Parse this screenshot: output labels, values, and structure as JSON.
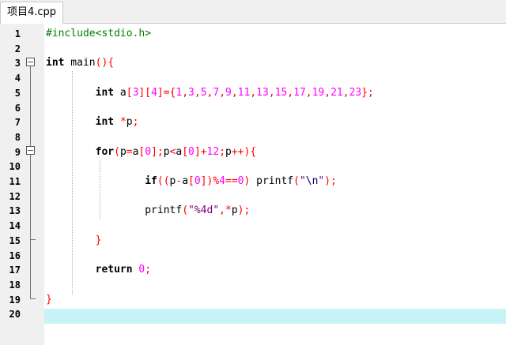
{
  "tab": {
    "label": "项目4.cpp"
  },
  "lines": [
    {
      "num": "1",
      "tokens": [
        {
          "t": "#include<stdio.h>",
          "c": "pp"
        }
      ]
    },
    {
      "num": "2",
      "tokens": []
    },
    {
      "num": "3",
      "tokens": [
        {
          "t": "int",
          "c": "kw"
        },
        {
          "t": " main",
          "c": ""
        },
        {
          "t": "(){",
          "c": "op"
        }
      ]
    },
    {
      "num": "4",
      "tokens": []
    },
    {
      "num": "5",
      "tokens": [
        {
          "t": "        ",
          "c": ""
        },
        {
          "t": "int",
          "c": "kw"
        },
        {
          "t": " a",
          "c": ""
        },
        {
          "t": "[",
          "c": "op"
        },
        {
          "t": "3",
          "c": "num"
        },
        {
          "t": "][",
          "c": "op"
        },
        {
          "t": "4",
          "c": "num"
        },
        {
          "t": "]={",
          "c": "op"
        },
        {
          "t": "1",
          "c": "num"
        },
        {
          "t": ",",
          "c": "op"
        },
        {
          "t": "3",
          "c": "num"
        },
        {
          "t": ",",
          "c": "op"
        },
        {
          "t": "5",
          "c": "num"
        },
        {
          "t": ",",
          "c": "op"
        },
        {
          "t": "7",
          "c": "num"
        },
        {
          "t": ",",
          "c": "op"
        },
        {
          "t": "9",
          "c": "num"
        },
        {
          "t": ",",
          "c": "op"
        },
        {
          "t": "11",
          "c": "num"
        },
        {
          "t": ",",
          "c": "op"
        },
        {
          "t": "13",
          "c": "num"
        },
        {
          "t": ",",
          "c": "op"
        },
        {
          "t": "15",
          "c": "num"
        },
        {
          "t": ",",
          "c": "op"
        },
        {
          "t": "17",
          "c": "num"
        },
        {
          "t": ",",
          "c": "op"
        },
        {
          "t": "19",
          "c": "num"
        },
        {
          "t": ",",
          "c": "op"
        },
        {
          "t": "21",
          "c": "num"
        },
        {
          "t": ",",
          "c": "op"
        },
        {
          "t": "23",
          "c": "num"
        },
        {
          "t": "};",
          "c": "op"
        }
      ]
    },
    {
      "num": "6",
      "tokens": []
    },
    {
      "num": "7",
      "tokens": [
        {
          "t": "        ",
          "c": ""
        },
        {
          "t": "int",
          "c": "kw"
        },
        {
          "t": " ",
          "c": ""
        },
        {
          "t": "*",
          "c": "op"
        },
        {
          "t": "p",
          "c": ""
        },
        {
          "t": ";",
          "c": "op"
        }
      ]
    },
    {
      "num": "8",
      "tokens": []
    },
    {
      "num": "9",
      "tokens": [
        {
          "t": "        ",
          "c": ""
        },
        {
          "t": "for",
          "c": "kw"
        },
        {
          "t": "(",
          "c": "op"
        },
        {
          "t": "p",
          "c": ""
        },
        {
          "t": "=",
          "c": "op"
        },
        {
          "t": "a",
          "c": ""
        },
        {
          "t": "[",
          "c": "op"
        },
        {
          "t": "0",
          "c": "num"
        },
        {
          "t": "];",
          "c": "op"
        },
        {
          "t": "p",
          "c": ""
        },
        {
          "t": "<",
          "c": "op"
        },
        {
          "t": "a",
          "c": ""
        },
        {
          "t": "[",
          "c": "op"
        },
        {
          "t": "0",
          "c": "num"
        },
        {
          "t": "]+",
          "c": "op"
        },
        {
          "t": "12",
          "c": "num"
        },
        {
          "t": ";",
          "c": "op"
        },
        {
          "t": "p",
          "c": ""
        },
        {
          "t": "++){",
          "c": "op"
        }
      ]
    },
    {
      "num": "10",
      "tokens": []
    },
    {
      "num": "11",
      "tokens": [
        {
          "t": "                ",
          "c": ""
        },
        {
          "t": "if",
          "c": "kw"
        },
        {
          "t": "((",
          "c": "op"
        },
        {
          "t": "p",
          "c": ""
        },
        {
          "t": "-",
          "c": "op"
        },
        {
          "t": "a",
          "c": ""
        },
        {
          "t": "[",
          "c": "op"
        },
        {
          "t": "0",
          "c": "num"
        },
        {
          "t": "])%",
          "c": "op"
        },
        {
          "t": "4",
          "c": "num"
        },
        {
          "t": "==",
          "c": "op"
        },
        {
          "t": "0",
          "c": "num"
        },
        {
          "t": ")",
          "c": "op"
        },
        {
          "t": " printf",
          "c": ""
        },
        {
          "t": "(",
          "c": "op"
        },
        {
          "t": "\"",
          "c": "str"
        },
        {
          "t": "\\n",
          "c": "esc"
        },
        {
          "t": "\"",
          "c": "str"
        },
        {
          "t": ");",
          "c": "op"
        }
      ]
    },
    {
      "num": "12",
      "tokens": []
    },
    {
      "num": "13",
      "tokens": [
        {
          "t": "                ",
          "c": ""
        },
        {
          "t": "printf",
          "c": ""
        },
        {
          "t": "(",
          "c": "op"
        },
        {
          "t": "\"%4d\"",
          "c": "str"
        },
        {
          "t": ",*",
          "c": "op"
        },
        {
          "t": "p",
          "c": ""
        },
        {
          "t": ");",
          "c": "op"
        }
      ]
    },
    {
      "num": "14",
      "tokens": []
    },
    {
      "num": "15",
      "tokens": [
        {
          "t": "        ",
          "c": ""
        },
        {
          "t": "}",
          "c": "op"
        }
      ]
    },
    {
      "num": "16",
      "tokens": []
    },
    {
      "num": "17",
      "tokens": [
        {
          "t": "        ",
          "c": ""
        },
        {
          "t": "return",
          "c": "kw"
        },
        {
          "t": " ",
          "c": ""
        },
        {
          "t": "0",
          "c": "num"
        },
        {
          "t": ";",
          "c": "op"
        }
      ]
    },
    {
      "num": "18",
      "tokens": []
    },
    {
      "num": "19",
      "tokens": [
        {
          "t": "}",
          "c": "op"
        }
      ]
    },
    {
      "num": "20",
      "tokens": []
    }
  ],
  "colors": {
    "current_line": "#c8f4f8",
    "keyword": "#000000",
    "preprocessor": "#008000",
    "number": "#ff00ff",
    "operator": "#ff0000",
    "string": "#800080"
  },
  "icons": [
    "fold-minus-icon",
    "fold-minus-icon"
  ]
}
